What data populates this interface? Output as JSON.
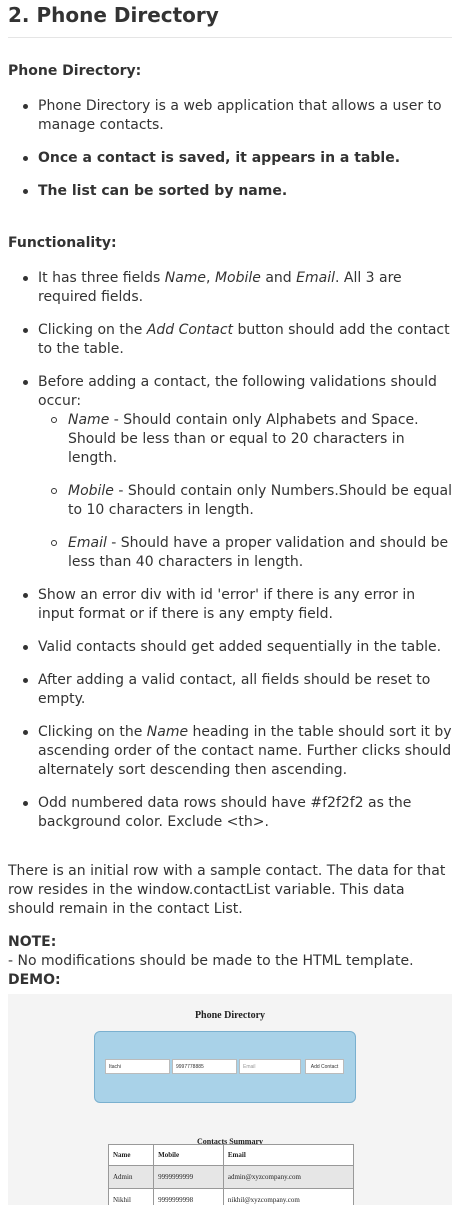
{
  "heading": "2. Phone Directory",
  "intro": {
    "title": "Phone Directory:",
    "items": [
      "Phone Directory is a web application that allows a user to manage contacts.",
      "Once a contact is saved, it appears in a table.",
      "The list can be sorted by name."
    ]
  },
  "functionality": {
    "title": "Functionality:",
    "item1": {
      "pre": "It has three fields ",
      "f1": "Name",
      "sep1": ", ",
      "f2": "Mobile",
      "sep2": " and ",
      "f3": "Email",
      "post": ". All 3 are required fields."
    },
    "item2": {
      "pre": "Clicking on the ",
      "em": "Add Contact",
      "post": " button should add the contact to the table."
    },
    "item3": {
      "text": "Before adding a contact, the following validations should occur:",
      "sub": [
        {
          "field": "Name",
          "text": " - Should contain only Alphabets and Space. Should be less than or equal to 20 characters in length."
        },
        {
          "field": "Mobile",
          "text": " - Should contain only Numbers.Should be equal to 10 characters in length."
        },
        {
          "field": "Email",
          "text": " - Should have a proper validation and should be less than 40 characters in length."
        }
      ]
    },
    "item4": "Show an error div with id 'error' if there is any error in input format or if there is any empty field.",
    "item5": "Valid contacts should get added sequentially in the table.",
    "item6": "After adding a valid contact, all fields should be reset to empty.",
    "item7": {
      "pre": "Clicking on the ",
      "em": "Name",
      "post": " heading in the table should sort it by ascending order of the contact name.  Further clicks should alternately sort descending then ascending."
    },
    "item8": "Odd numbered data rows should have #f2f2f2 as the background color. Exclude <th>."
  },
  "initial_row_text": "There is an initial row with a sample contact. The data for that row resides in the window.contactList variable. This data should remain in the contact List.",
  "note": {
    "title": "NOTE:",
    "text": " - No modifications should be made to the HTML template."
  },
  "demo": {
    "title": "DEMO:",
    "app_title": "Phone Directory",
    "name_value": "Itachi",
    "mobile_value": "9997778885",
    "email_placeholder": "Email",
    "add_button": "Add Contact",
    "summary_title": "Contacts Summary",
    "columns": [
      "Name",
      "Mobile",
      "Email"
    ],
    "rows": [
      [
        "Admin",
        "9999999999",
        "admin@xyzcompany.com"
      ],
      [
        "Nikhil",
        "9999999998",
        "nikhil@xyzcompany.com"
      ]
    ],
    "colors": {
      "form_bg": "#a9d2e8",
      "odd_row": "#e6e6e6"
    }
  }
}
